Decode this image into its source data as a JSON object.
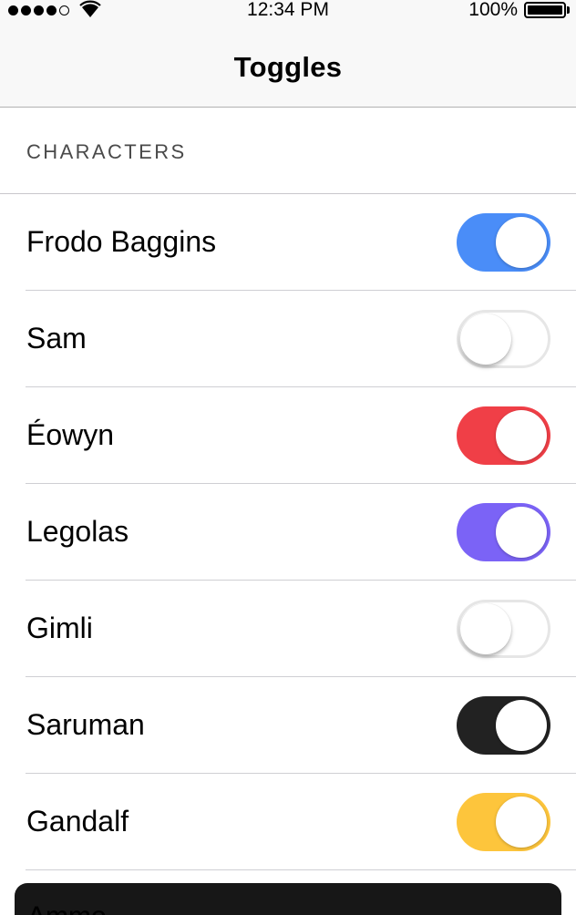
{
  "status_bar": {
    "signal_icon": "signal-dots-icon",
    "wifi_icon": "wifi-icon",
    "time": "12:34 PM",
    "battery_percent": "100%",
    "battery_icon": "battery-full-icon",
    "battery_level": 1.0
  },
  "nav": {
    "title": "Toggles"
  },
  "section": {
    "title": "CHARACTERS"
  },
  "characters": [
    {
      "name": "Frodo Baggins",
      "on": true,
      "color": "#4a8df8"
    },
    {
      "name": "Sam",
      "on": false,
      "color": "#ffffff"
    },
    {
      "name": "Éowyn",
      "on": true,
      "color": "#f03f47"
    },
    {
      "name": "Legolas",
      "on": true,
      "color": "#7b63f6"
    },
    {
      "name": "Gimli",
      "on": false,
      "color": "#ffffff"
    },
    {
      "name": "Saruman",
      "on": true,
      "color": "#222222"
    },
    {
      "name": "Gandalf",
      "on": true,
      "color": "#fdc53c"
    }
  ],
  "bottom_sheet": {
    "label": "Ammo"
  }
}
